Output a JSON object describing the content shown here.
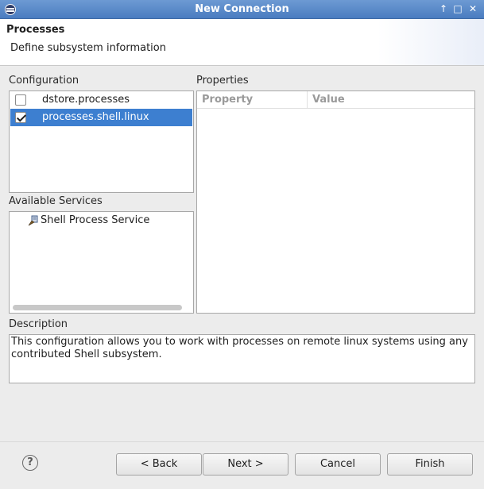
{
  "window": {
    "title": "New Connection",
    "controls": [
      "↑",
      "□",
      "✕"
    ]
  },
  "header": {
    "title": "Processes",
    "subtitle": "Define subsystem information"
  },
  "configuration": {
    "label": "Configuration",
    "items": [
      {
        "label": "dstore.processes",
        "checked": false,
        "selected": false
      },
      {
        "label": "processes.shell.linux",
        "checked": true,
        "selected": true
      }
    ]
  },
  "available_services": {
    "label": "Available Services",
    "items": [
      {
        "label": "Shell Process Service",
        "icon": "service-icon"
      }
    ]
  },
  "properties": {
    "label": "Properties",
    "columns": [
      "Property",
      "Value"
    ]
  },
  "description": {
    "label": "Description",
    "text": "This configuration allows you to work with processes on remote linux systems using any contributed Shell subsystem."
  },
  "buttons": {
    "help": "?",
    "back": "< Back",
    "next": "Next >",
    "cancel": "Cancel",
    "finish": "Finish"
  },
  "colors": {
    "selection": "#3d7fd0",
    "titlebar": "#5b8bca"
  }
}
